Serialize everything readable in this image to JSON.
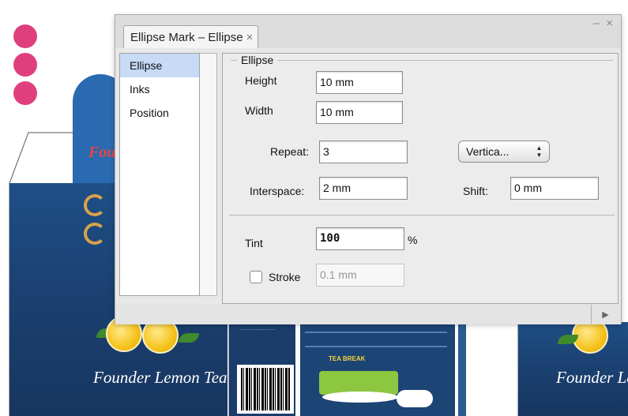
{
  "background": {
    "brand_text": "Founder Lemon Tea",
    "brand_partial": "Founder Le",
    "brand_top_partial": "Fou",
    "tea_break": "TEA BREAK"
  },
  "dialog": {
    "tab_title": "Ellipse Mark – Ellipse",
    "tab_close": "×",
    "minimize": "–",
    "close": "×",
    "nav_items": [
      "Ellipse",
      "Inks",
      "Position"
    ],
    "group_title": "Ellipse",
    "height_label": "Height",
    "height_value": "10 mm",
    "width_label": "Width",
    "width_value": "10 mm",
    "repeat_label": "Repeat:",
    "repeat_value": "3",
    "direction_value": "Vertica...",
    "interspace_label": "Interspace:",
    "interspace_value": "2 mm",
    "shift_label": "Shift:",
    "shift_value": "0 mm",
    "tint_label": "Tint",
    "tint_value": "100",
    "tint_unit": "%",
    "stroke_label": "Stroke",
    "stroke_value": "0.1 mm",
    "stroke_checked": false,
    "footer_arrow": "▶"
  }
}
